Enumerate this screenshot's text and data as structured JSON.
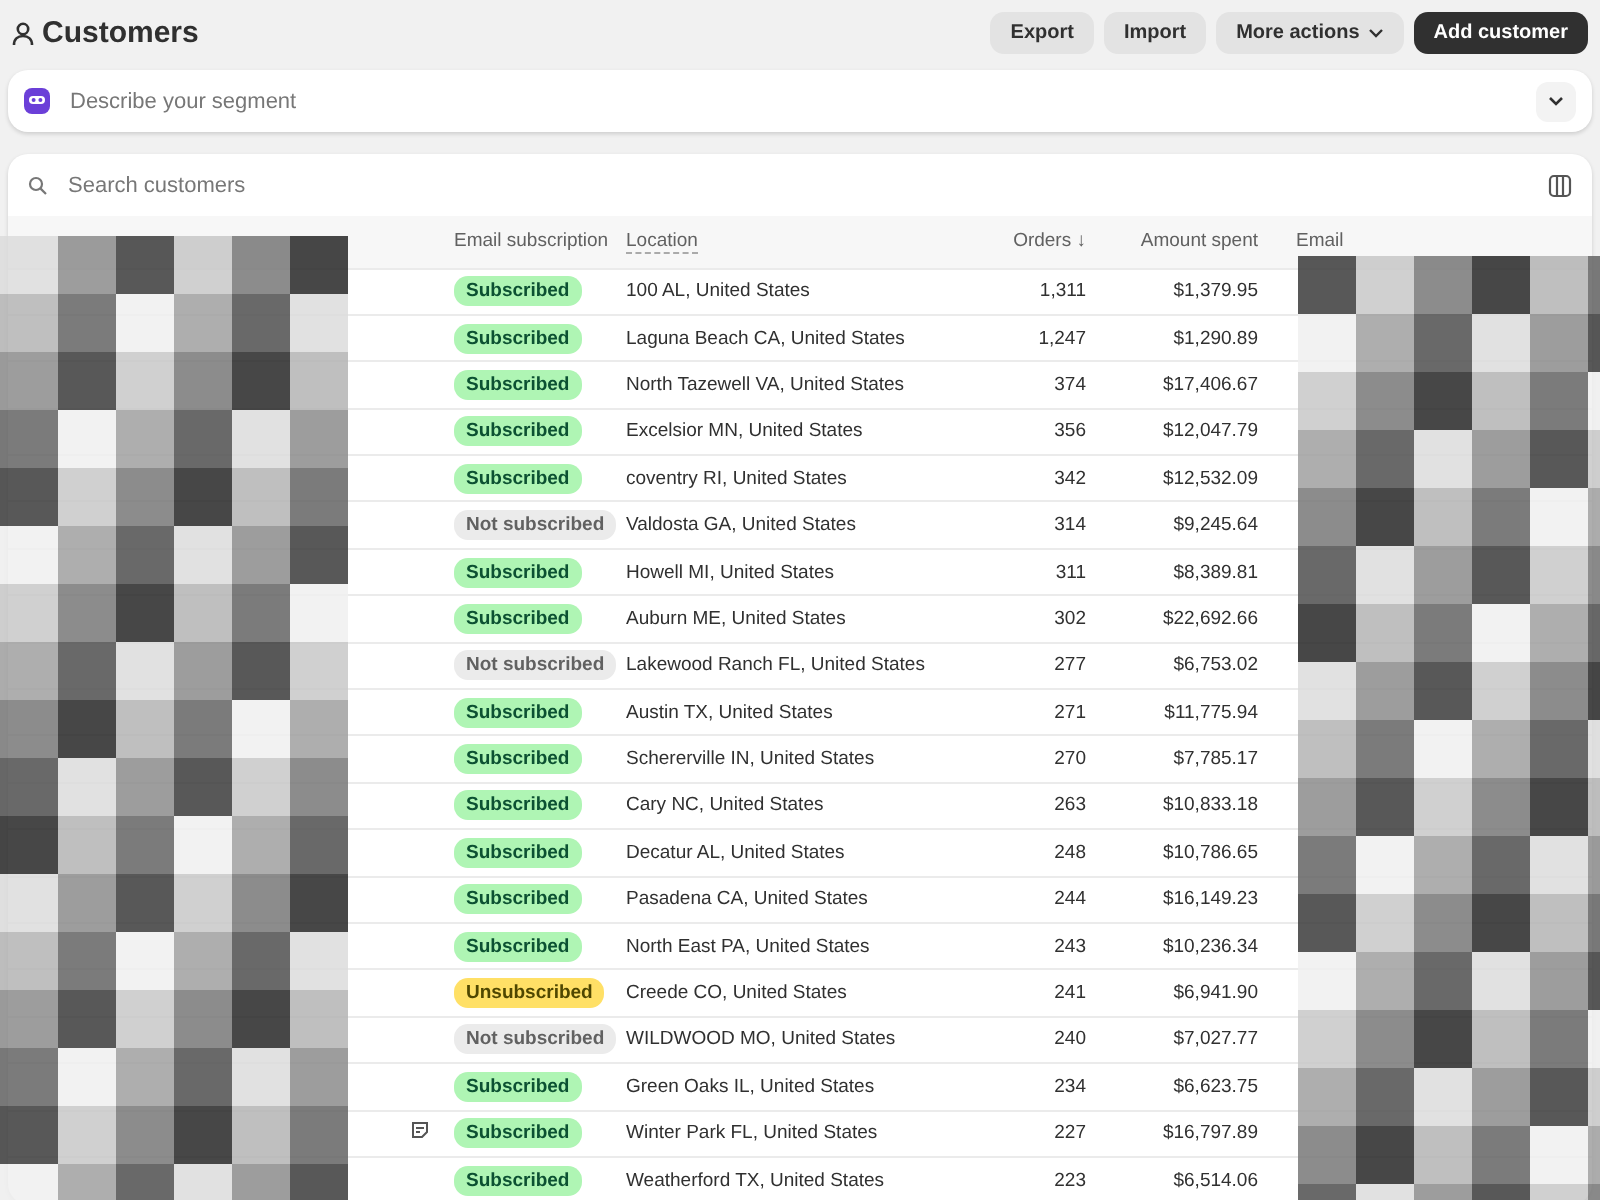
{
  "page": {
    "title": "Customers"
  },
  "actions": [
    {
      "label": "Export",
      "kind": "secondary"
    },
    {
      "label": "Import",
      "kind": "secondary"
    },
    {
      "label": "More actions",
      "kind": "menu"
    },
    {
      "label": "Add customer",
      "kind": "primary"
    }
  ],
  "segment": {
    "placeholder": "Describe your segment"
  },
  "search": {
    "placeholder": "Search customers"
  },
  "table": {
    "columns": [
      {
        "label": "Email subscription",
        "kind": "plain"
      },
      {
        "label": "Location",
        "kind": "underlined"
      },
      {
        "label": "Orders ↓",
        "kind": "number"
      },
      {
        "label": "Amount spent",
        "kind": "number"
      },
      {
        "label": "Email",
        "kind": "plain"
      }
    ],
    "rows": [
      {
        "has_note": false,
        "subscription": {
          "label": "Subscribed",
          "kind": "subscribed"
        },
        "location": "100 AL, United States",
        "orders": "1,311",
        "amount": "$1,379.95"
      },
      {
        "has_note": false,
        "subscription": {
          "label": "Subscribed",
          "kind": "subscribed"
        },
        "location": "Laguna Beach CA, United States",
        "orders": "1,247",
        "amount": "$1,290.89"
      },
      {
        "has_note": false,
        "subscription": {
          "label": "Subscribed",
          "kind": "subscribed"
        },
        "location": "North Tazewell VA, United States",
        "orders": "374",
        "amount": "$17,406.67"
      },
      {
        "has_note": false,
        "subscription": {
          "label": "Subscribed",
          "kind": "subscribed"
        },
        "location": "Excelsior MN, United States",
        "orders": "356",
        "amount": "$12,047.79"
      },
      {
        "has_note": false,
        "subscription": {
          "label": "Subscribed",
          "kind": "subscribed"
        },
        "location": "coventry RI, United States",
        "orders": "342",
        "amount": "$12,532.09"
      },
      {
        "has_note": false,
        "subscription": {
          "label": "Not subscribed",
          "kind": "not_subscribed"
        },
        "location": "Valdosta GA, United States",
        "orders": "314",
        "amount": "$9,245.64"
      },
      {
        "has_note": false,
        "subscription": {
          "label": "Subscribed",
          "kind": "subscribed"
        },
        "location": "Howell MI, United States",
        "orders": "311",
        "amount": "$8,389.81"
      },
      {
        "has_note": false,
        "subscription": {
          "label": "Subscribed",
          "kind": "subscribed"
        },
        "location": "Auburn ME, United States",
        "orders": "302",
        "amount": "$22,692.66"
      },
      {
        "has_note": false,
        "subscription": {
          "label": "Not subscribed",
          "kind": "not_subscribed"
        },
        "location": "Lakewood Ranch FL, United States",
        "orders": "277",
        "amount": "$6,753.02"
      },
      {
        "has_note": false,
        "subscription": {
          "label": "Subscribed",
          "kind": "subscribed"
        },
        "location": "Austin TX, United States",
        "orders": "271",
        "amount": "$11,775.94"
      },
      {
        "has_note": false,
        "subscription": {
          "label": "Subscribed",
          "kind": "subscribed"
        },
        "location": "Schererville IN, United States",
        "orders": "270",
        "amount": "$7,785.17"
      },
      {
        "has_note": false,
        "subscription": {
          "label": "Subscribed",
          "kind": "subscribed"
        },
        "location": "Cary NC, United States",
        "orders": "263",
        "amount": "$10,833.18"
      },
      {
        "has_note": false,
        "subscription": {
          "label": "Subscribed",
          "kind": "subscribed"
        },
        "location": "Decatur AL, United States",
        "orders": "248",
        "amount": "$10,786.65"
      },
      {
        "has_note": false,
        "subscription": {
          "label": "Subscribed",
          "kind": "subscribed"
        },
        "location": "Pasadena CA, United States",
        "orders": "244",
        "amount": "$16,149.23"
      },
      {
        "has_note": false,
        "subscription": {
          "label": "Subscribed",
          "kind": "subscribed"
        },
        "location": "North East PA, United States",
        "orders": "243",
        "amount": "$10,236.34"
      },
      {
        "has_note": false,
        "subscription": {
          "label": "Unsubscribed",
          "kind": "unsubscribed"
        },
        "location": "Creede CO, United States",
        "orders": "241",
        "amount": "$6,941.90"
      },
      {
        "has_note": false,
        "subscription": {
          "label": "Not subscribed",
          "kind": "not_subscribed"
        },
        "location": "WILDWOOD MO, United States",
        "orders": "240",
        "amount": "$7,027.77"
      },
      {
        "has_note": false,
        "subscription": {
          "label": "Subscribed",
          "kind": "subscribed"
        },
        "location": "Green Oaks IL, United States",
        "orders": "234",
        "amount": "$6,623.75"
      },
      {
        "has_note": true,
        "subscription": {
          "label": "Subscribed",
          "kind": "subscribed"
        },
        "location": "Winter Park FL, United States",
        "orders": "227",
        "amount": "$16,797.89"
      },
      {
        "has_note": false,
        "subscription": {
          "label": "Subscribed",
          "kind": "subscribed"
        },
        "location": "Weatherford TX, United States",
        "orders": "223",
        "amount": "$6,514.06"
      }
    ]
  }
}
